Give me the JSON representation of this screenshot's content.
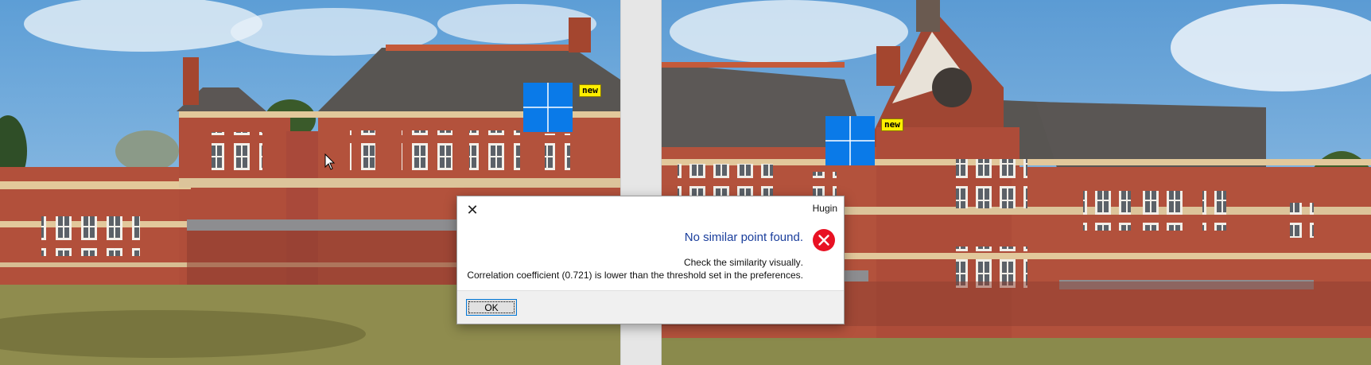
{
  "left_image": {
    "marker": {
      "label": "new",
      "color": "#0a7ae8"
    }
  },
  "right_image": {
    "marker": {
      "label": "new",
      "color": "#0a7ae8"
    }
  },
  "dialog": {
    "title": "Hugin",
    "close_glyph": "✕",
    "icon": "error-circle-icon",
    "heading": ".No similar point found",
    "line1": ".Check the similarity visually",
    "line2": ".Correlation coefficient (0.721) is lower than the threshold set in the preferences",
    "ok_label": "OK"
  },
  "colors": {
    "error_red": "#e81123",
    "heading_blue": "#1a3e9c",
    "marker_blue": "#0a7ae8",
    "tag_yellow": "#ffef00"
  }
}
